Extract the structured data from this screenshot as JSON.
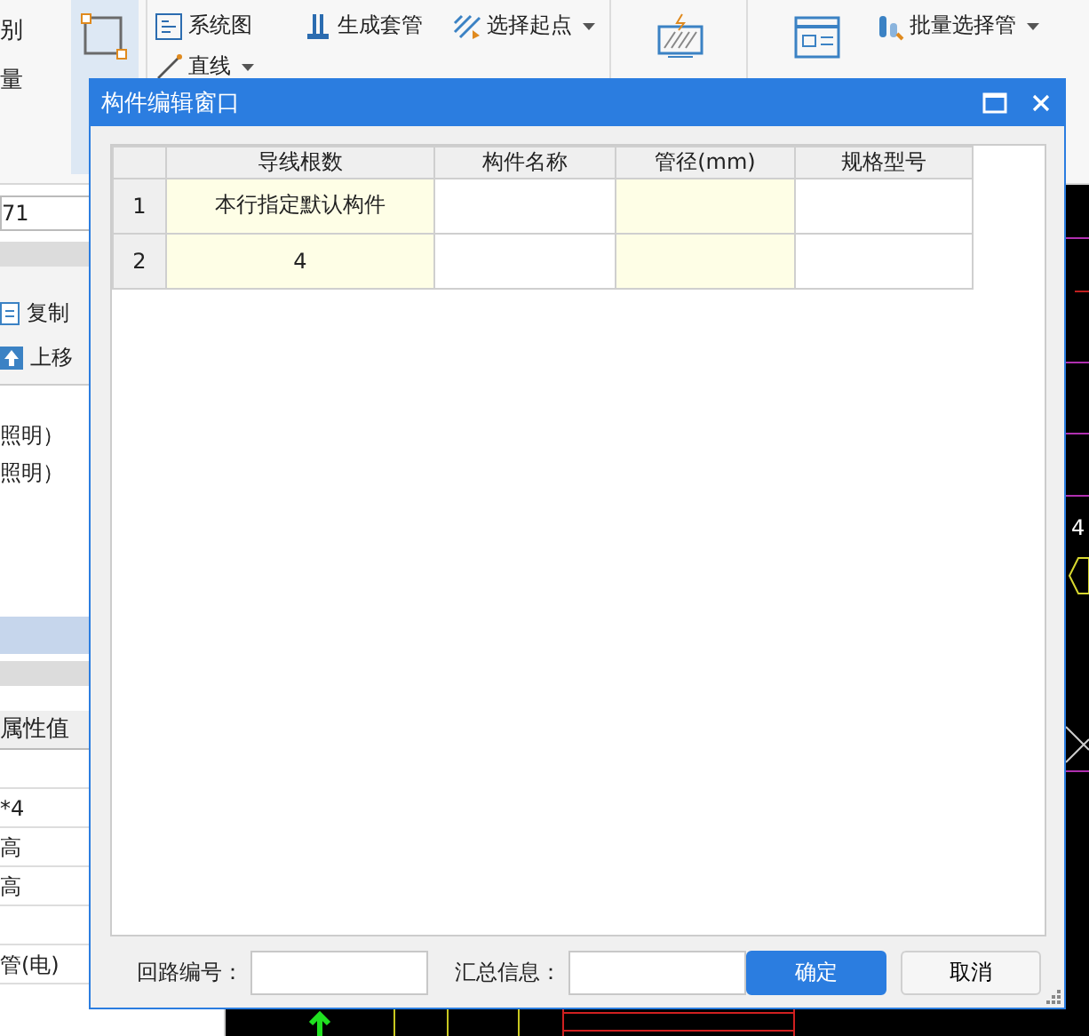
{
  "ribbon": {
    "left_labels": [
      "别",
      "量"
    ],
    "big_tool": {
      "selected": true
    },
    "tools": [
      {
        "label": "系统图",
        "dropdown": false
      },
      {
        "label": "直线",
        "dropdown": true
      },
      {
        "label": "生成套管",
        "dropdown": false
      },
      {
        "label": "选择起点",
        "dropdown": true
      },
      {
        "label": "批量选择管",
        "dropdown": true
      }
    ]
  },
  "left_panel": {
    "field_value": "71",
    "actions": [
      "复制",
      "上移"
    ],
    "list_items": [
      {
        "label": "照明）",
        "selected": false
      },
      {
        "label": "照明）",
        "selected": false
      },
      {
        "selected": false
      },
      {
        "selected": false
      },
      {
        "selected": true
      }
    ],
    "properties": {
      "header": "属性值",
      "rows": [
        {},
        {
          "value": "*4"
        },
        {
          "value": "高"
        },
        {
          "value": "高"
        },
        {},
        {
          "value": "管(电)"
        }
      ]
    }
  },
  "cad": {
    "labels": [
      "4"
    ]
  },
  "dialog": {
    "title": "构件编辑窗口",
    "columns": [
      {
        "label": "导线根数",
        "highlight": true
      },
      {
        "label": "构件名称",
        "highlight": false
      },
      {
        "label": "管径(mm)",
        "highlight": true
      },
      {
        "label": "规格型号",
        "highlight": false
      }
    ],
    "rows": [
      {
        "number": "1",
        "cells": [
          "本行指定默认构件",
          "",
          "",
          ""
        ]
      },
      {
        "number": "2",
        "cells": [
          "4",
          "",
          "",
          ""
        ]
      }
    ],
    "fields": [
      {
        "label": "回路编号："
      },
      {
        "label": "汇总信息："
      }
    ],
    "buttons": [
      {
        "label": "确定",
        "primary": true
      },
      {
        "label": "取消",
        "primary": false
      }
    ]
  }
}
